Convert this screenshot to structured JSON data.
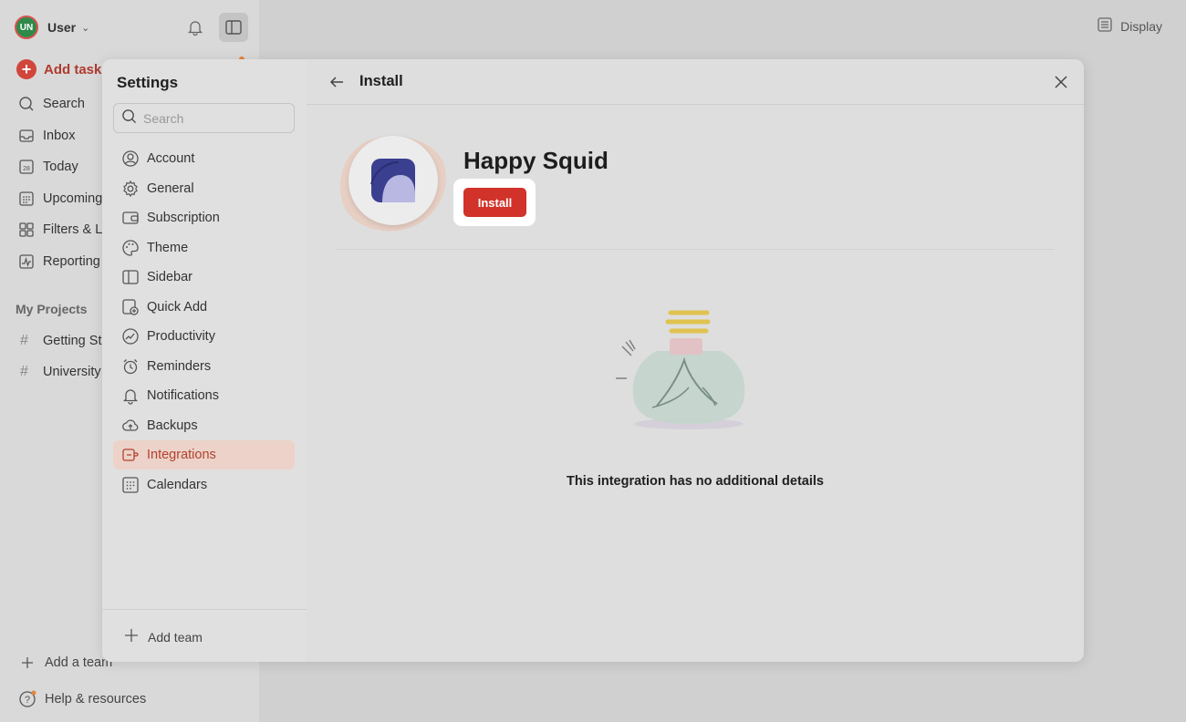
{
  "app": {
    "user": {
      "initials": "UN",
      "name": "User"
    },
    "add_task_label": "Add task",
    "nav": [
      {
        "label": "Search",
        "icon": "search-icon"
      },
      {
        "label": "Inbox",
        "icon": "inbox-icon"
      },
      {
        "label": "Today",
        "icon": "calendar-day-icon",
        "day": "28"
      },
      {
        "label": "Upcoming",
        "icon": "calendar-grid-icon"
      },
      {
        "label": "Filters & Labels",
        "icon": "filters-icon"
      },
      {
        "label": "Reporting",
        "icon": "reporting-icon"
      }
    ],
    "projects_title": "My Projects",
    "projects": [
      {
        "label": "Getting Started"
      },
      {
        "label": "University"
      }
    ],
    "add_team_label": "Add a team",
    "help_label": "Help & resources",
    "display_label": "Display"
  },
  "settings": {
    "title": "Settings",
    "search_placeholder": "Search",
    "items": [
      {
        "label": "Account",
        "icon": "account-icon"
      },
      {
        "label": "General",
        "icon": "gear-icon"
      },
      {
        "label": "Subscription",
        "icon": "wallet-icon"
      },
      {
        "label": "Theme",
        "icon": "palette-icon"
      },
      {
        "label": "Sidebar",
        "icon": "sidebar-icon"
      },
      {
        "label": "Quick Add",
        "icon": "quick-add-icon"
      },
      {
        "label": "Productivity",
        "icon": "productivity-icon"
      },
      {
        "label": "Reminders",
        "icon": "alarm-icon"
      },
      {
        "label": "Notifications",
        "icon": "bell-icon"
      },
      {
        "label": "Backups",
        "icon": "cloud-icon"
      },
      {
        "label": "Integrations",
        "icon": "integrations-icon",
        "active": true
      },
      {
        "label": "Calendars",
        "icon": "calendar-grid-icon"
      }
    ],
    "add_team_label": "Add team"
  },
  "install_page": {
    "title": "Install",
    "app_name": "Happy Squid",
    "install_label": "Install",
    "empty_message": "This integration has no additional details"
  },
  "colors": {
    "accent": "#d1322a",
    "active_bg": "#ecd2c8",
    "active_text": "#b3412f"
  }
}
